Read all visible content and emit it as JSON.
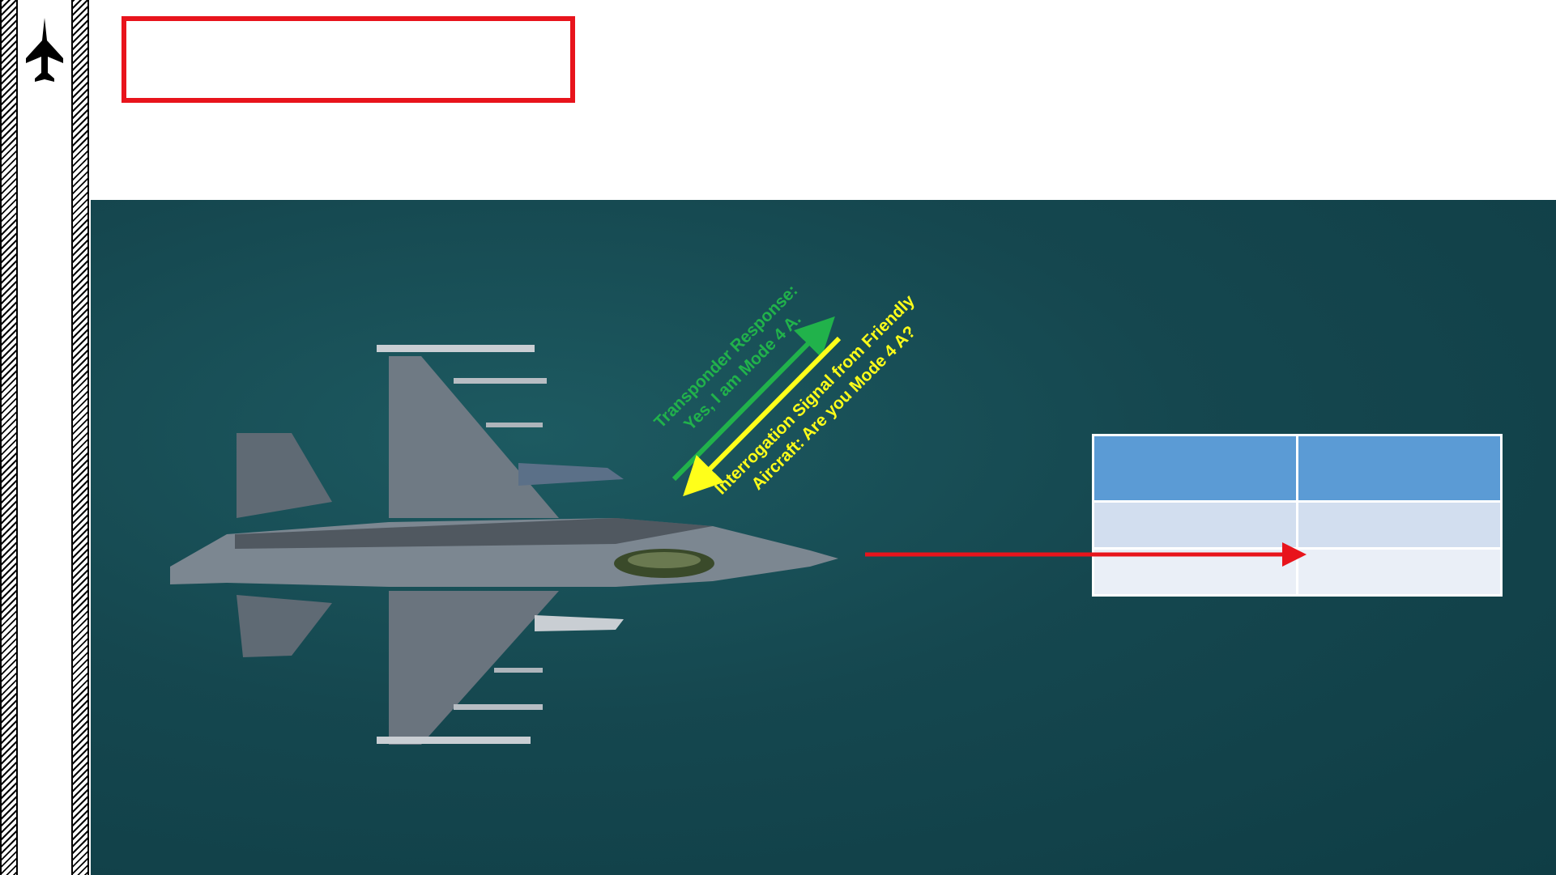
{
  "slide": {
    "title": "",
    "logo_icon": "jet-silhouette-icon"
  },
  "labels": {
    "transponder_line1": "Transponder Response:",
    "transponder_line2": "Yes, I am Mode 4 A.",
    "interrogation_line1": "Interrogation Signal from Friendly",
    "interrogation_line2": "Aircraft: Are you Mode 4 A?"
  },
  "table": {
    "header": [
      "",
      ""
    ],
    "rows": [
      [
        "",
        ""
      ],
      [
        "",
        ""
      ]
    ]
  },
  "colors": {
    "title_border": "#e8141c",
    "response_arrow": "#21b24b",
    "interrogation_arrow": "#ffff1a",
    "heading_arrow": "#e8141c",
    "table_header": "#5b9bd5"
  }
}
